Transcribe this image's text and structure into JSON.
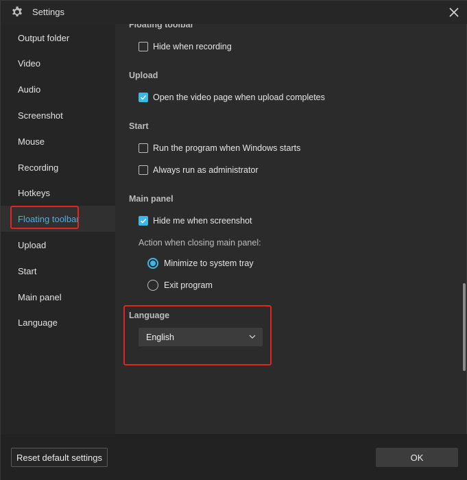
{
  "window": {
    "title": "Settings",
    "title_icon": "gear-icon",
    "close_icon": "close-icon"
  },
  "sidebar": {
    "items": [
      {
        "label": "Output folder"
      },
      {
        "label": "Video"
      },
      {
        "label": "Audio"
      },
      {
        "label": "Screenshot"
      },
      {
        "label": "Mouse"
      },
      {
        "label": "Recording"
      },
      {
        "label": "Hotkeys"
      },
      {
        "label": "Floating toolbar",
        "active": true
      },
      {
        "label": "Upload"
      },
      {
        "label": "Start"
      },
      {
        "label": "Main panel"
      },
      {
        "label": "Language"
      }
    ]
  },
  "content": {
    "floating_toolbar": {
      "title": "Floating toolbar",
      "hide_when_recording": {
        "label": "Hide when recording",
        "checked": false
      }
    },
    "upload": {
      "title": "Upload",
      "open_video_page": {
        "label": "Open the video page when upload completes",
        "checked": true
      }
    },
    "start": {
      "title": "Start",
      "run_on_windows_start": {
        "label": "Run the program when Windows starts",
        "checked": false
      },
      "run_as_admin": {
        "label": "Always run as administrator",
        "checked": false
      }
    },
    "main_panel": {
      "title": "Main panel",
      "hide_when_screenshot": {
        "label": "Hide me when screenshot",
        "checked": true
      },
      "closing_action_label": "Action when closing main panel:",
      "options": [
        {
          "label": "Minimize to system tray",
          "selected": true
        },
        {
          "label": "Exit program",
          "selected": false
        }
      ]
    },
    "language": {
      "title": "Language",
      "selected": "English"
    }
  },
  "footer": {
    "reset_label": "Reset default settings",
    "ok_label": "OK"
  },
  "colors": {
    "accent": "#3ab8e8",
    "highlight_box": "#e0261e",
    "background": "#2b2b2b",
    "sidebar": "#252525"
  }
}
